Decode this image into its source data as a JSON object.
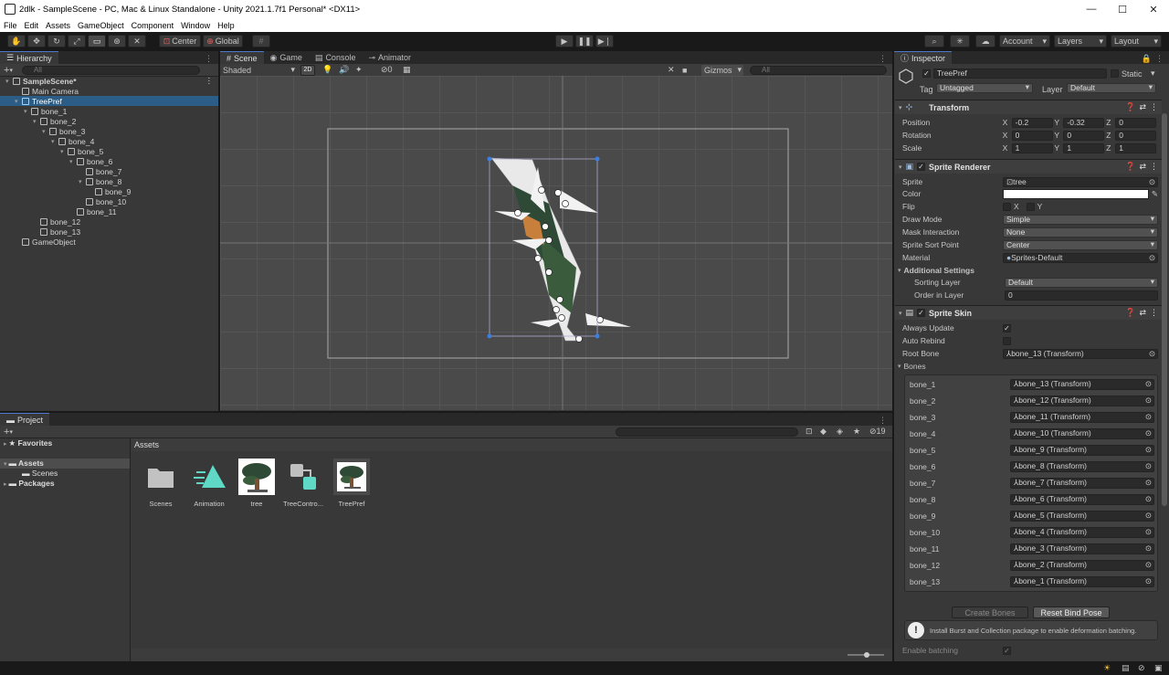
{
  "window": {
    "title": "2dlk - SampleScene - PC, Mac & Linux Standalone - Unity 2021.1.7f1 Personal* <DX11>",
    "min": "—",
    "max": "☐",
    "close": "✕"
  },
  "menu": [
    "File",
    "Edit",
    "Assets",
    "GameObject",
    "Component",
    "Window",
    "Help"
  ],
  "toolbar": {
    "center": "Center",
    "global": "Global",
    "account": "Account",
    "layers": "Layers",
    "layout": "Layout"
  },
  "hierarchy": {
    "tab": "Hierarchy",
    "search_placeholder": "All",
    "rows": [
      {
        "label": "SampleScene*",
        "indent": 0,
        "kind": "scene"
      },
      {
        "label": "Main Camera",
        "indent": 1,
        "kind": "obj"
      },
      {
        "label": "TreePref",
        "indent": 1,
        "kind": "obj",
        "selected": true
      },
      {
        "label": "bone_1",
        "indent": 2,
        "kind": "obj"
      },
      {
        "label": "bone_2",
        "indent": 3,
        "kind": "obj"
      },
      {
        "label": "bone_3",
        "indent": 4,
        "kind": "obj"
      },
      {
        "label": "bone_4",
        "indent": 5,
        "kind": "obj"
      },
      {
        "label": "bone_5",
        "indent": 6,
        "kind": "obj"
      },
      {
        "label": "bone_6",
        "indent": 7,
        "kind": "obj"
      },
      {
        "label": "bone_7",
        "indent": 8,
        "kind": "obj"
      },
      {
        "label": "bone_8",
        "indent": 8,
        "kind": "obj"
      },
      {
        "label": "bone_9",
        "indent": 9,
        "kind": "obj"
      },
      {
        "label": "bone_10",
        "indent": 8,
        "kind": "obj"
      },
      {
        "label": "bone_11",
        "indent": 7,
        "kind": "obj"
      },
      {
        "label": "bone_12",
        "indent": 3,
        "kind": "obj"
      },
      {
        "label": "bone_13",
        "indent": 3,
        "kind": "obj"
      },
      {
        "label": "GameObject",
        "indent": 1,
        "kind": "obj"
      }
    ]
  },
  "scene": {
    "tabs": [
      "Scene",
      "Game",
      "Console",
      "Animator"
    ],
    "shading": "Shaded",
    "mode2d": "2D",
    "gizmos": "Gizmos",
    "search_placeholder": "All",
    "hidden_count": "0"
  },
  "project": {
    "tab": "Project",
    "favorites": "Favorites",
    "assets": "Assets",
    "scenes": "Scenes",
    "packages": "Packages",
    "assets_header": "Assets",
    "count": "19",
    "items": [
      {
        "label": "Scenes",
        "icon": "folder-icon"
      },
      {
        "label": "Animation",
        "icon": "animation-icon"
      },
      {
        "label": "tree",
        "icon": "tree-thumbnail"
      },
      {
        "label": "TreeContro...",
        "icon": "animator-controller-icon"
      },
      {
        "label": "TreePref",
        "icon": "prefab-thumbnail"
      }
    ]
  },
  "inspector": {
    "tab": "Inspector",
    "object_name": "TreePref",
    "static": "Static",
    "tag_label": "Tag",
    "tag": "Untagged",
    "layer_label": "Layer",
    "layer": "Default",
    "transform": {
      "title": "Transform",
      "rows": [
        {
          "label": "Position",
          "x": "-0.2",
          "y": "-0.32",
          "z": "0"
        },
        {
          "label": "Rotation",
          "x": "0",
          "y": "0",
          "z": "0"
        },
        {
          "label": "Scale",
          "x": "1",
          "y": "1",
          "z": "1"
        }
      ]
    },
    "sprite_renderer": {
      "title": "Sprite Renderer",
      "sprite_label": "Sprite",
      "sprite": "tree",
      "color_label": "Color",
      "flip_label": "Flip",
      "flip_x": "X",
      "flip_y": "Y",
      "draw_mode_label": "Draw Mode",
      "draw_mode": "Simple",
      "mask_label": "Mask Interaction",
      "mask": "None",
      "sort_point_label": "Sprite Sort Point",
      "sort_point": "Center",
      "material_label": "Material",
      "material": "Sprites-Default",
      "additional": "Additional Settings",
      "sorting_layer_label": "Sorting Layer",
      "sorting_layer": "Default",
      "order_label": "Order in Layer",
      "order": "0"
    },
    "sprite_skin": {
      "title": "Sprite Skin",
      "always_update_label": "Always Update",
      "auto_rebind_label": "Auto Rebind",
      "root_bone_label": "Root Bone",
      "root_bone": "bone_13 (Transform)",
      "bones_label": "Bones",
      "bones": [
        {
          "name": "bone_1",
          "ref": "bone_13 (Transform)"
        },
        {
          "name": "bone_2",
          "ref": "bone_12 (Transform)"
        },
        {
          "name": "bone_3",
          "ref": "bone_11 (Transform)"
        },
        {
          "name": "bone_4",
          "ref": "bone_10 (Transform)"
        },
        {
          "name": "bone_5",
          "ref": "bone_9 (Transform)"
        },
        {
          "name": "bone_6",
          "ref": "bone_8 (Transform)"
        },
        {
          "name": "bone_7",
          "ref": "bone_7 (Transform)"
        },
        {
          "name": "bone_8",
          "ref": "bone_6 (Transform)"
        },
        {
          "name": "bone_9",
          "ref": "bone_5 (Transform)"
        },
        {
          "name": "bone_10",
          "ref": "bone_4 (Transform)"
        },
        {
          "name": "bone_11",
          "ref": "bone_3 (Transform)"
        },
        {
          "name": "bone_12",
          "ref": "bone_2 (Transform)"
        },
        {
          "name": "bone_13",
          "ref": "bone_1 (Transform)"
        }
      ],
      "create_bones": "Create Bones",
      "reset_bind": "Reset Bind Pose",
      "info": "Install Burst and Collection package to enable deformation batching.",
      "enable_batching": "Enable batching"
    }
  }
}
